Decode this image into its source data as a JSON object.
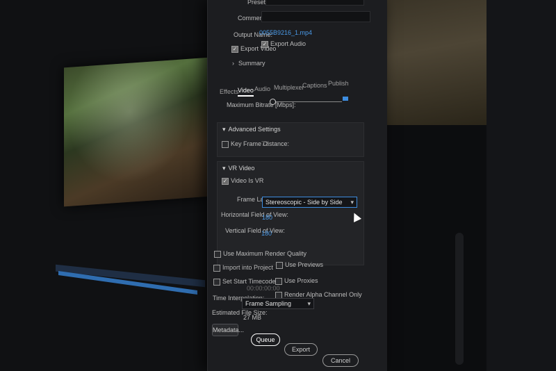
{
  "dialog": {
    "preset_label": "Preset:",
    "comments_label": "Comments:",
    "output_name_label": "Output Name:",
    "output_name_value": "0055B9216_1.mp4",
    "export_video_label": "Export Video",
    "export_audio_label": "Export Audio",
    "summary_label": "Summary",
    "tabs": [
      "Effects",
      "Video",
      "Audio",
      "Multiplexer",
      "Captions",
      "Publish"
    ],
    "max_bitrate_label": "Maximum Bitrate [Mbps]:",
    "advanced_settings_label": "Advanced Settings",
    "key_frame_label": "Key Frame Distance:",
    "key_frame_value": "72",
    "vr_video_label": "VR Video",
    "video_is_vr_label": "Video Is VR",
    "frame_layout_label": "Frame Layout:",
    "frame_layout_value": "Stereoscopic - Side by Side",
    "hfov_label": "Horizontal Field of View:",
    "hfov_value": "180",
    "vfov_label": "Vertical Field of View:",
    "vfov_value": "180",
    "use_max_render_label": "Use Maximum Render Quality",
    "use_previews_label": "Use Previews",
    "import_into_project_label": "Import into Project",
    "use_proxies_label": "Use Proxies",
    "set_start_timecode_label": "Set Start Timecode",
    "start_timecode_value": "00:00:00:00",
    "render_alpha_label": "Render Alpha Channel Only",
    "time_interp_label": "Time Interpolation:",
    "time_interp_value": "Frame Sampling",
    "est_file_size_label": "Estimated File Size:",
    "est_file_size_value": "27 MB",
    "metadata_button": "Metadata...",
    "queue_button": "Queue",
    "export_button": "Export",
    "cancel_button": "Cancel"
  },
  "colors": {
    "accent": "#3d8de0",
    "link": "#4a9ae8",
    "dialog_bg": "#1c1d20"
  }
}
